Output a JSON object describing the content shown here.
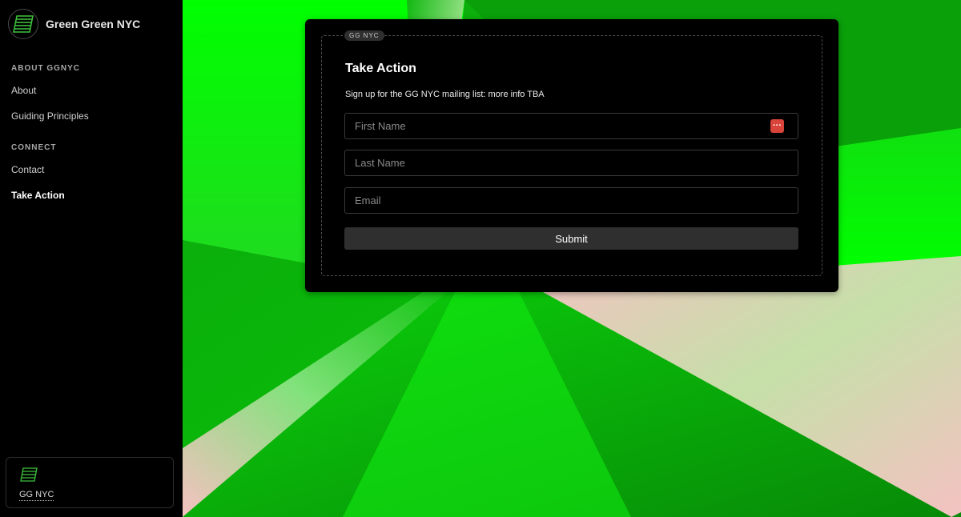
{
  "sidebar": {
    "brand": {
      "name": "Green Green NYC",
      "logo_icon": "striped-parallelogram-logo"
    },
    "sections": [
      {
        "title": "ABOUT GGNYC",
        "items": [
          {
            "label": "About"
          },
          {
            "label": "Guiding Principles"
          }
        ]
      },
      {
        "title": "CONNECT",
        "items": [
          {
            "label": "Contact"
          },
          {
            "label": "Take Action",
            "active": true
          }
        ]
      }
    ],
    "footer": {
      "label": "GG NYC",
      "logo_icon": "striped-parallelogram-logo"
    }
  },
  "form": {
    "chip": "GG NYC",
    "title": "Take Action",
    "description": "Sign up for the GG NYC mailing list: more info TBA",
    "first_name_placeholder": "First Name",
    "last_name_placeholder": "Last Name",
    "email_placeholder": "Email",
    "password_manager_icon": "password-manager-icon",
    "submit_label": "Submit"
  },
  "colors": {
    "accent_green": "#00e000",
    "dark_green": "#0a8f0a",
    "pink": "#f5c2c2",
    "password_manager_red": "#d9443a"
  }
}
